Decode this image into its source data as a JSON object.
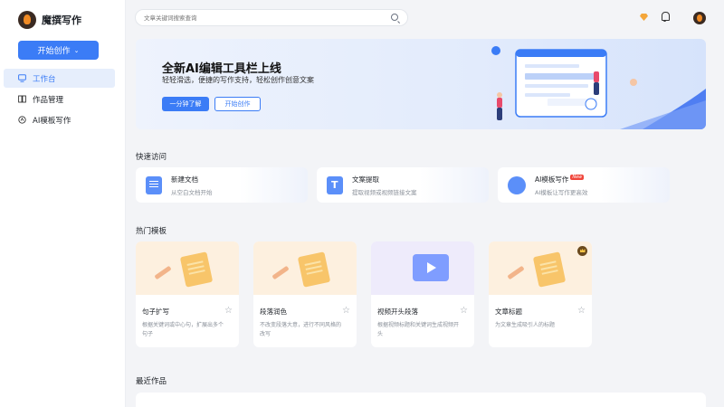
{
  "sidebar": {
    "logo_text": "魔撰写作",
    "start_button": "开始创作",
    "nav": [
      {
        "label": "工作台",
        "icon": "monitor-icon",
        "active": true
      },
      {
        "label": "作品管理",
        "icon": "book-icon",
        "active": false
      },
      {
        "label": "AI模板写作",
        "icon": "ai-spark-icon",
        "active": false
      }
    ]
  },
  "topbar": {
    "search_placeholder": "文章关键词搜索查询"
  },
  "banner": {
    "title": "全新AI编辑工具栏上线",
    "subtitle": "轻轻滑选，便捷的写作支持，轻松创作创意文案",
    "primary_button": "一分钟了解",
    "secondary_button": "开始创作"
  },
  "quick_access": {
    "title": "快速访问",
    "items": [
      {
        "title": "新建文档",
        "desc": "从空白文档开始",
        "icon": "document-icon"
      },
      {
        "title": "文案提取",
        "desc": "提取视频或视频链接文案",
        "icon": "text-extract-icon"
      },
      {
        "title": "AI模板写作",
        "badge": "New",
        "desc": "AI模板让写作更高效",
        "icon": "ai-template-icon"
      }
    ]
  },
  "templates": {
    "title": "热门模板",
    "items": [
      {
        "name": "句子扩写",
        "desc": "根据关键词或中心句，扩展出多个句子"
      },
      {
        "name": "段落润色",
        "desc": "不改变段落大意，进行不同风格的改写"
      },
      {
        "name": "视频开头段落",
        "desc": "根据视频标题和关键词生成视频开头"
      },
      {
        "name": "文章标题",
        "desc": "为文章生成吸引人的标题"
      }
    ]
  },
  "recent": {
    "title": "最近作品"
  },
  "colors": {
    "accent": "#3b7cf6",
    "badge": "#f0453a"
  }
}
